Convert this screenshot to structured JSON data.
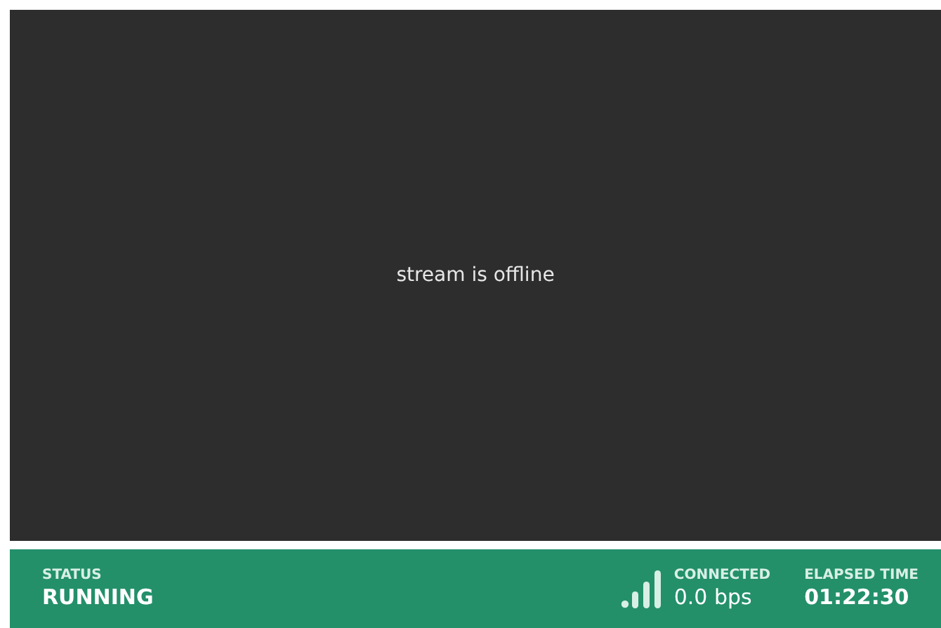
{
  "player": {
    "message": "stream is offline"
  },
  "status_bar": {
    "items": [
      {
        "label": "STATUS",
        "value": "RUNNING",
        "kind": "status"
      },
      {
        "label": "CONNECTED",
        "value": "0.0 bps",
        "kind": "connection"
      },
      {
        "label": "ELAPSED TIME",
        "value": "01:22:30",
        "kind": "time"
      }
    ]
  }
}
